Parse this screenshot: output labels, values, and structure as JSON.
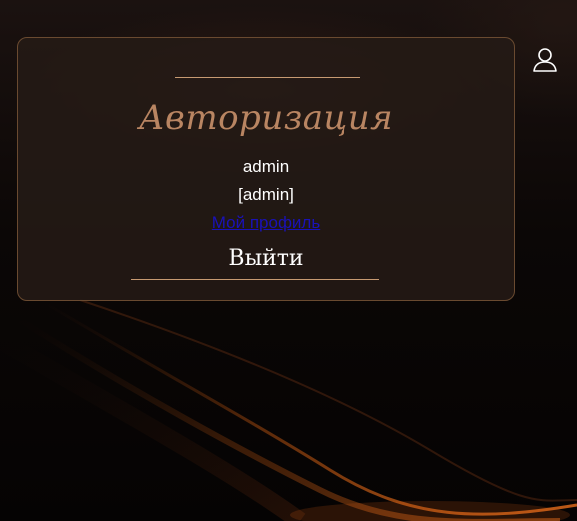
{
  "auth_panel": {
    "title": "Авторизация",
    "username": "admin",
    "role": "[admin]",
    "profile_link": "Мой профиль",
    "logout_label": "Выйти"
  },
  "header": {
    "user_icon": "user-icon"
  },
  "colors": {
    "accent": "#c79a72",
    "title": "#b98562",
    "link": "#1a12b8"
  }
}
